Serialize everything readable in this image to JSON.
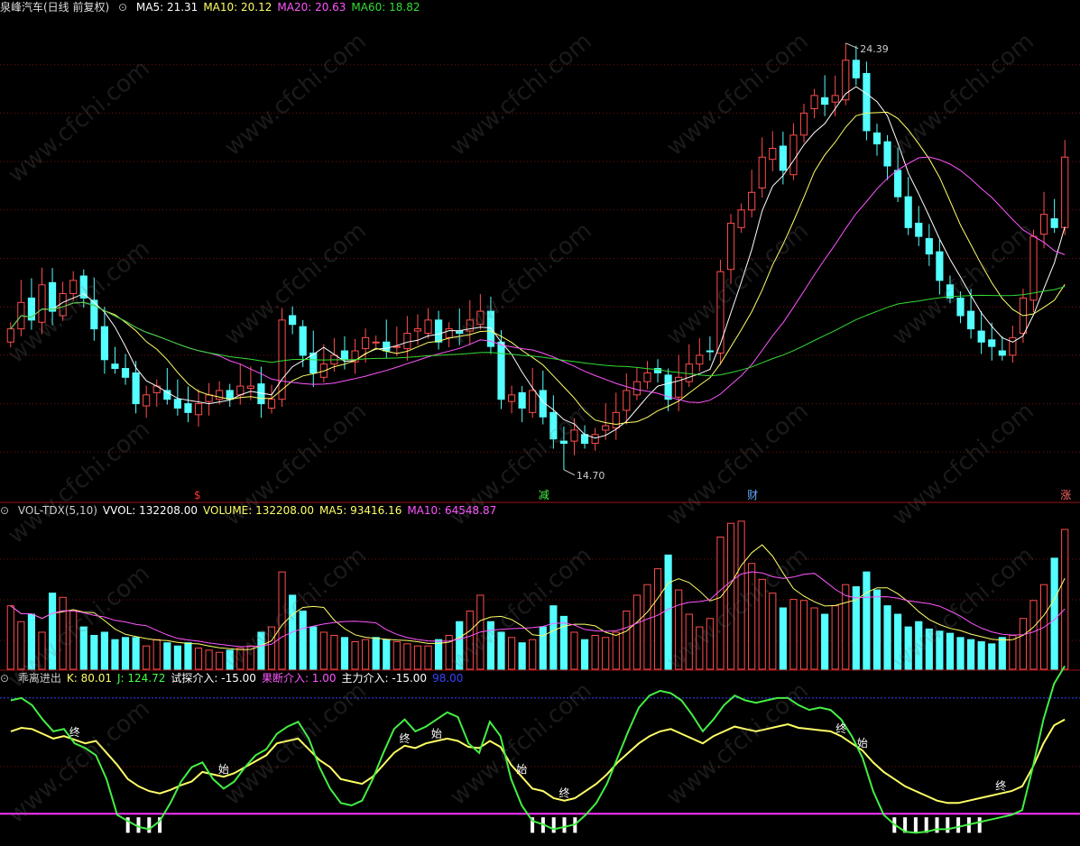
{
  "app": {
    "security_name": "泉峰汽车(日线 前复权)",
    "colors": {
      "up": "#ff4d4d",
      "down": "#54ffff",
      "ma5": "#ffffff",
      "ma10": "#ffff66",
      "ma20": "#ff55ff",
      "ma60": "#33dd33",
      "grid": "#7a1010",
      "bg": "#000000"
    }
  },
  "main_panel": {
    "legend": [
      {
        "text": "MA5: 21.31",
        "color": "#ffffff"
      },
      {
        "text": "MA10: 20.12",
        "color": "#ffff66"
      },
      {
        "text": "MA20: 20.63",
        "color": "#ff55ff"
      },
      {
        "text": "MA60: 18.82",
        "color": "#33dd33"
      }
    ],
    "high_label": "24.39",
    "low_label": "14.70",
    "markers": [
      {
        "text": "$",
        "color": "#ff3333"
      },
      {
        "text": "减",
        "color": "#44ee44"
      },
      {
        "text": "财",
        "color": "#66aaff"
      },
      {
        "text": "涨",
        "color": "#ff6666"
      }
    ]
  },
  "volume_panel": {
    "legend": [
      {
        "text": "VOL-TDX(5,10)",
        "color": "#cccccc"
      },
      {
        "text": "VVOL: 132208.00",
        "color": "#ffffff"
      },
      {
        "text": "VOLUME: 132208.00",
        "color": "#ffff66"
      },
      {
        "text": "MA5: 93416.16",
        "color": "#ffff66"
      },
      {
        "text": "MA10: 64548.87",
        "color": "#ff55ff"
      }
    ]
  },
  "indicator_panel": {
    "legend": [
      {
        "text": "乖离进出",
        "color": "#cccccc"
      },
      {
        "text": "K: 80.01",
        "color": "#ffff66"
      },
      {
        "text": "J: 124.72",
        "color": "#44ff44"
      },
      {
        "text": "试探介入: -15.00",
        "color": "#ffffff"
      },
      {
        "text": "果断介入: 1.00",
        "color": "#ff55ff"
      },
      {
        "text": "主力介入: -15.00",
        "color": "#ffffff"
      },
      {
        "text": "98.00",
        "color": "#3344ff"
      }
    ],
    "labels_start": "始",
    "labels_end": "终"
  },
  "watermark": "www.cfchi.com",
  "chart_data": [
    {
      "type": "candlestick",
      "title": "泉峰汽车(日线 前复权)",
      "price_range": [
        14.0,
        25.0
      ],
      "high": 24.39,
      "low": 14.7,
      "close": [
        17.9,
        18.5,
        18.1,
        18.9,
        18.3,
        18.7,
        19.0,
        18.6,
        17.9,
        17.2,
        17.0,
        16.8,
        16.2,
        16.4,
        16.6,
        16.3,
        16.1,
        16.0,
        16.2,
        16.4,
        16.5,
        16.3,
        16.6,
        16.6,
        16.2,
        16.3,
        18.1,
        18.0,
        17.3,
        16.9,
        17.1,
        17.3,
        17.2,
        17.4,
        17.7,
        17.6,
        17.4,
        17.5,
        17.8,
        17.9,
        18.1,
        17.6,
        17.9,
        17.8,
        18.1,
        18.3,
        17.5,
        16.3,
        16.4,
        16.1,
        16.5,
        15.9,
        15.4,
        15.3,
        15.6,
        15.3,
        15.5,
        15.7,
        16.0,
        16.5,
        16.7,
        16.9,
        16.9,
        16.3,
        16.8,
        17.1,
        17.3,
        17.4,
        19.2,
        20.3,
        20.6,
        21.0,
        21.8,
        22.0,
        21.5,
        22.3,
        22.8,
        23.2,
        23.0,
        23.2,
        24.0,
        23.6,
        22.4,
        22.1,
        21.6,
        20.9,
        20.2,
        20.0,
        19.6,
        19.0,
        18.6,
        18.2,
        17.9,
        17.6,
        17.5,
        17.3,
        17.7,
        18.6,
        20.0,
        20.5,
        20.2,
        21.8
      ],
      "series": [
        {
          "name": "MA5",
          "last": 21.31
        },
        {
          "name": "MA10",
          "last": 20.12
        },
        {
          "name": "MA20",
          "last": 20.63
        },
        {
          "name": "MA60",
          "last": 18.82
        }
      ]
    },
    {
      "type": "bar",
      "title": "VOL-TDX(5,10)",
      "last_volume": 132208.0,
      "volume_max": 145000,
      "volumes": [
        60000,
        45000,
        52000,
        35000,
        72000,
        68000,
        55000,
        40000,
        32000,
        35000,
        28000,
        30000,
        30000,
        22000,
        28000,
        25000,
        22000,
        25000,
        20000,
        18000,
        16000,
        18000,
        20000,
        22000,
        35000,
        40000,
        92000,
        70000,
        55000,
        40000,
        35000,
        32000,
        30000,
        26000,
        28000,
        30000,
        28000,
        26000,
        24000,
        22000,
        22000,
        28000,
        32000,
        45000,
        55000,
        70000,
        45000,
        35000,
        30000,
        25000,
        28000,
        40000,
        60000,
        50000,
        35000,
        28000,
        32000,
        30000,
        35000,
        55000,
        70000,
        80000,
        95000,
        108000,
        75000,
        52000,
        40000,
        48000,
        125000,
        138000,
        140000,
        100000,
        85000,
        72000,
        58000,
        66000,
        65000,
        58000,
        52000,
        60000,
        80000,
        78000,
        92000,
        75000,
        60000,
        52000,
        40000,
        45000,
        38000,
        36000,
        34000,
        30000,
        28000,
        26000,
        24000,
        30000,
        32000,
        48000,
        65000,
        80000,
        105000,
        132208
      ],
      "series": [
        {
          "name": "MA5",
          "last": 93416.16
        },
        {
          "name": "MA10",
          "last": 64548.87
        }
      ]
    },
    {
      "type": "line",
      "title": "乖离进出",
      "y_range": [
        -20,
        110
      ],
      "series": [
        {
          "name": "K",
          "last": 80.01,
          "values": [
            70,
            73,
            72,
            68,
            64,
            66,
            63,
            60,
            62,
            52,
            42,
            30,
            24,
            20,
            18,
            21,
            25,
            28,
            36,
            34,
            32,
            35,
            40,
            45,
            50,
            60,
            62,
            64,
            55,
            46,
            40,
            30,
            28,
            26,
            32,
            42,
            52,
            58,
            56,
            60,
            62,
            64,
            62,
            57,
            56,
            62,
            57,
            42,
            32,
            22,
            20,
            14,
            12,
            14,
            20,
            26,
            34,
            44,
            52,
            60,
            66,
            70,
            72,
            68,
            64,
            60,
            66,
            70,
            74,
            72,
            70,
            72,
            74,
            76,
            73,
            72,
            71,
            70,
            66,
            60,
            54,
            44,
            36,
            30,
            24,
            20,
            16,
            12,
            10,
            10,
            12,
            14,
            16,
            18,
            20,
            24,
            40,
            60,
            75,
            80.01
          ]
        },
        {
          "name": "J",
          "last": 124.72,
          "values": [
            96,
            98,
            92,
            80,
            70,
            72,
            60,
            56,
            50,
            30,
            0,
            -5,
            -10,
            -12,
            -5,
            10,
            28,
            40,
            44,
            30,
            22,
            28,
            40,
            50,
            55,
            68,
            74,
            78,
            64,
            40,
            22,
            10,
            8,
            12,
            30,
            52,
            72,
            80,
            70,
            74,
            80,
            86,
            82,
            60,
            52,
            78,
            66,
            30,
            8,
            -5,
            -8,
            -12,
            -10,
            -8,
            0,
            10,
            26,
            48,
            70,
            90,
            100,
            104,
            102,
            96,
            84,
            70,
            80,
            92,
            100,
            96,
            94,
            96,
            98,
            98,
            92,
            88,
            90,
            88,
            80,
            66,
            48,
            20,
            0,
            -8,
            -14,
            -15,
            -14,
            -12,
            -12,
            -10,
            -8,
            -6,
            -4,
            -2,
            0,
            4,
            40,
            80,
            110,
            124.72
          ]
        }
      ]
    }
  ]
}
